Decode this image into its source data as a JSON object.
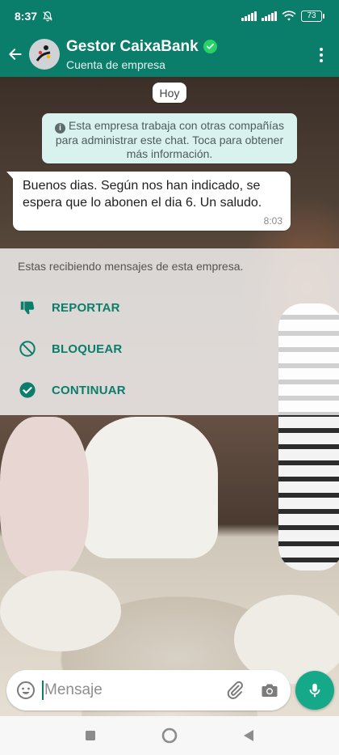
{
  "status_bar": {
    "time": "8:37",
    "battery": "73"
  },
  "header": {
    "title": "Gestor CaixaBank",
    "subtitle": "Cuenta de empresa"
  },
  "chat": {
    "date_chip": "Hoy",
    "system_notice": "Esta empresa trabaja con otras compañías para administrar este chat. Toca para obtener más información.",
    "message": {
      "text": "Buenos dias. Según nos han indicado, se espera que lo abonen el dia 6. Un saludo.",
      "time": "8:03"
    }
  },
  "action_panel": {
    "notice": "Estas recibiendo mensajes de esta empresa.",
    "report_label": "REPORTAR",
    "block_label": "BLOQUEAR",
    "continue_label": "CONTINUAR"
  },
  "composer": {
    "placeholder": "Mensaje"
  },
  "colors": {
    "header": "#0b7d6b",
    "accent": "#0b7d6b",
    "mic": "#15a98a",
    "verified": "#25d366"
  },
  "icons": [
    "mute-icon",
    "signal-icon",
    "wifi-icon",
    "battery-icon",
    "back-arrow-icon",
    "verified-icon",
    "more-vert-icon",
    "info-icon",
    "thumbs-down-icon",
    "block-icon",
    "check-circle-icon",
    "emoji-icon",
    "attach-icon",
    "camera-icon",
    "mic-icon",
    "nav-recents-icon",
    "nav-home-icon",
    "nav-back-icon"
  ]
}
